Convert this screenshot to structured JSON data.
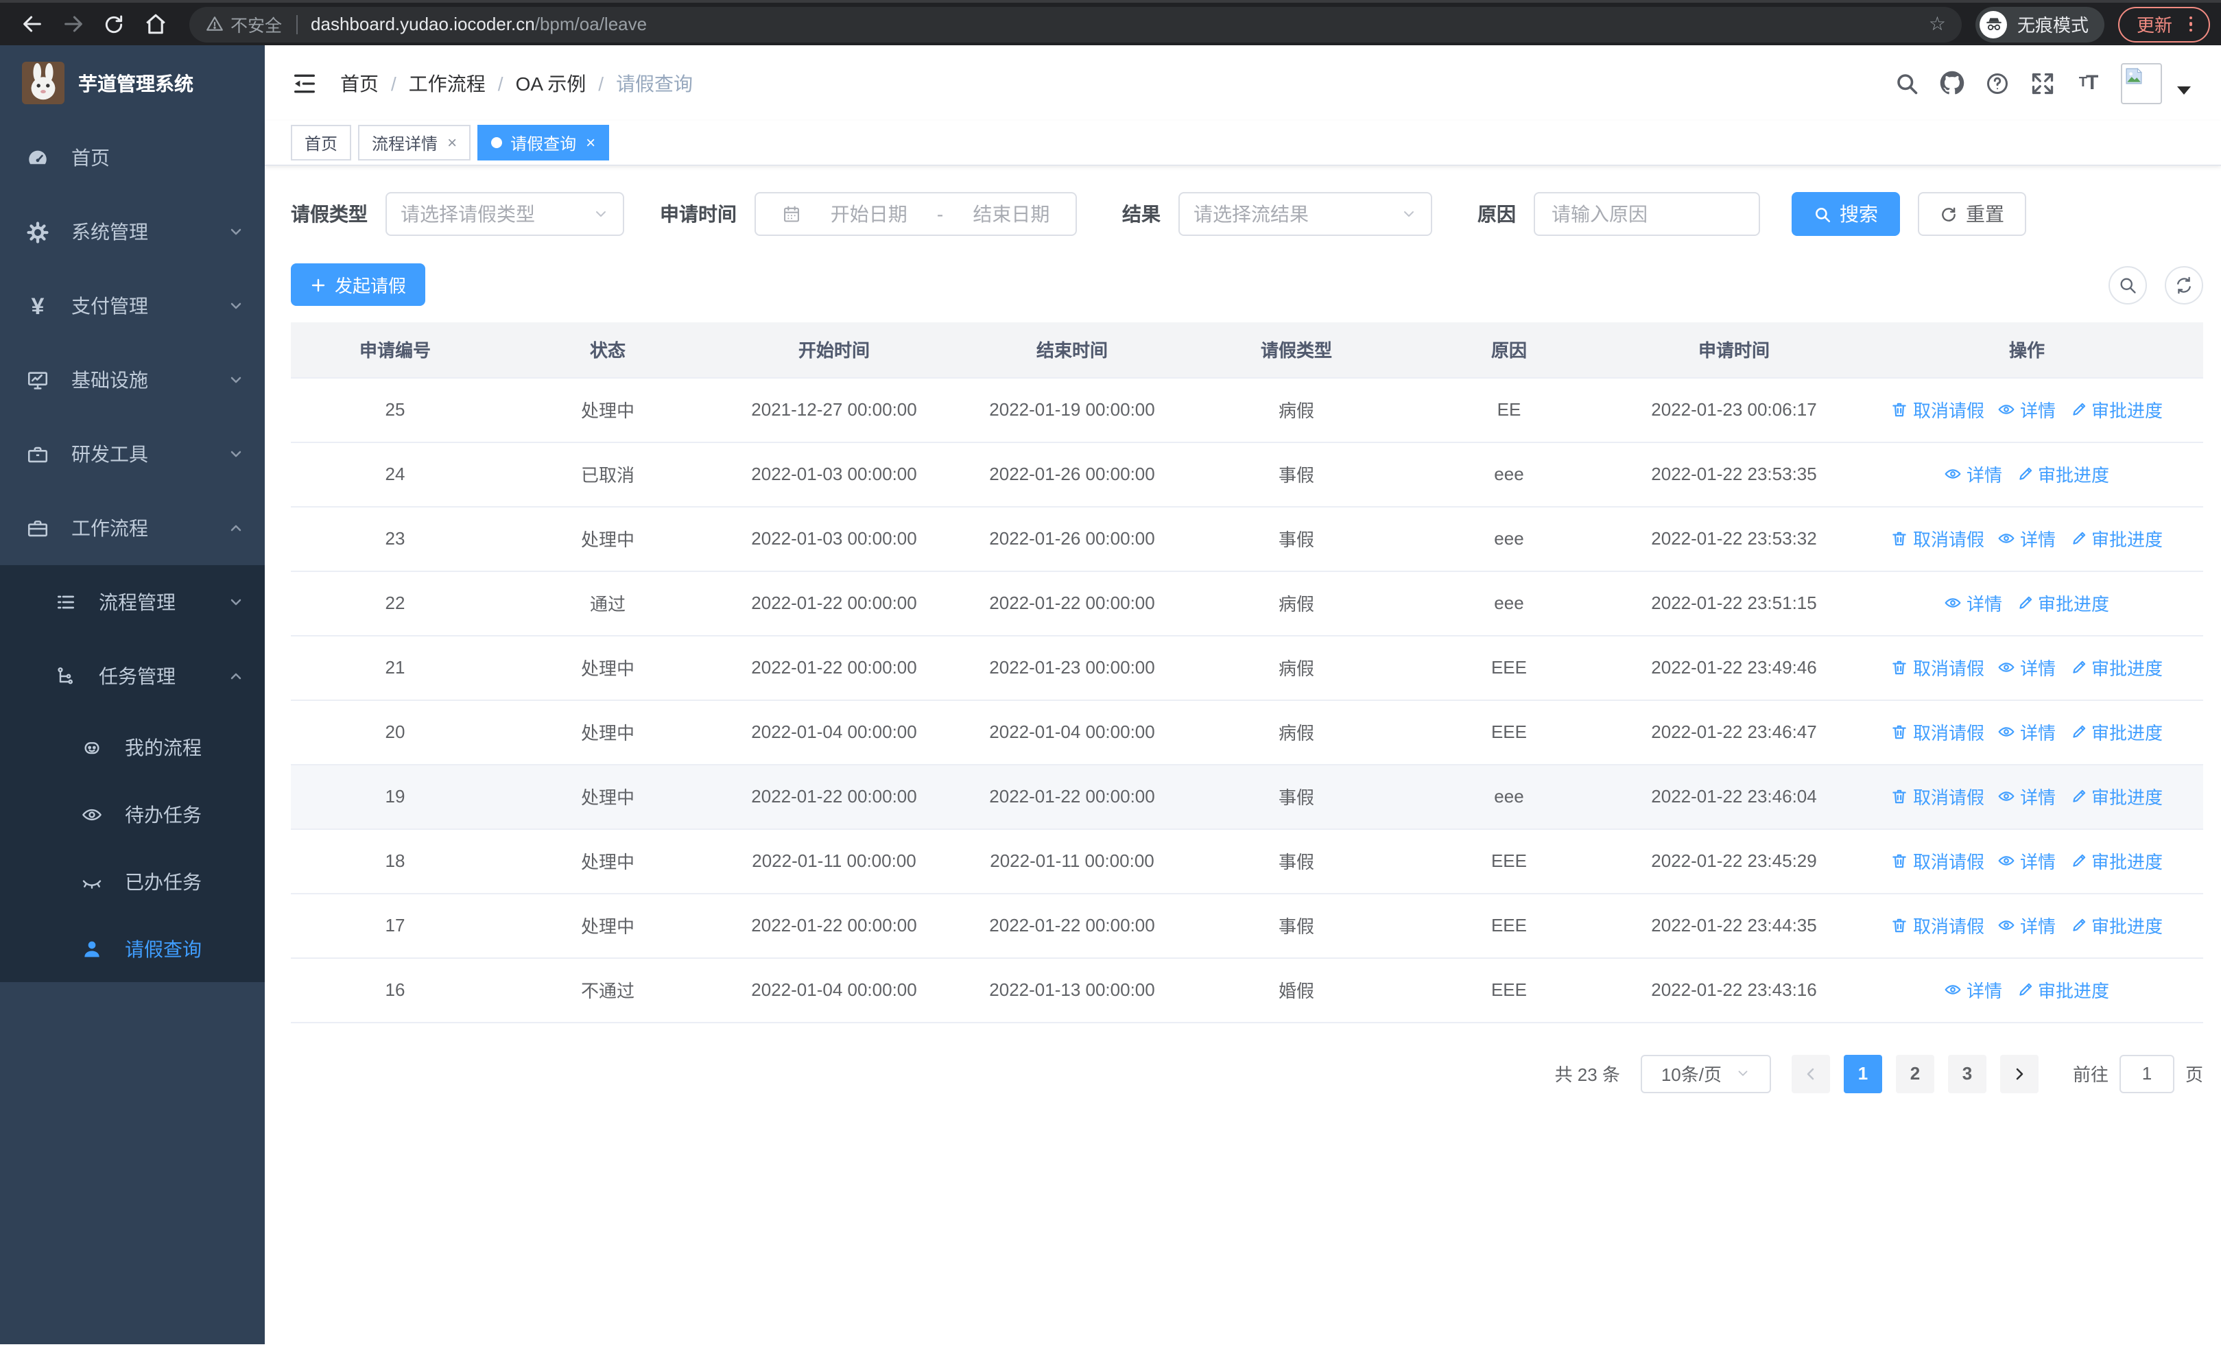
{
  "browser": {
    "security_label": "不安全",
    "url_domain": "dashboard.yudao.iocoder.cn",
    "url_path": "/bpm/oa/leave",
    "incognito_label": "无痕模式",
    "update_label": "更新"
  },
  "glyphs": {
    "star": "☆",
    "breadcrumb_separator": "/",
    "close": "×",
    "date_separator": "-"
  },
  "colors": {
    "accent": "#409eff",
    "sidebar_bg": "#304156",
    "submenu_bg": "#1f2d3d",
    "chrome_bg": "#202124",
    "update_accent": "#f28b82",
    "table_header_bg": "#f3f4f6"
  },
  "sidebar": {
    "logo_title": "芋道管理系统",
    "menu": [
      {
        "label": "首页",
        "icon": "dashboard-icon"
      },
      {
        "label": "系统管理",
        "icon": "gear-icon",
        "expandable": true
      },
      {
        "label": "支付管理",
        "icon": "yen-icon",
        "expandable": true
      },
      {
        "label": "基础设施",
        "icon": "monitor-icon",
        "expandable": true
      },
      {
        "label": "研发工具",
        "icon": "toolbox-icon",
        "expandable": true
      },
      {
        "label": "工作流程",
        "icon": "briefcase-icon",
        "expandable": true,
        "expanded": true,
        "children": [
          {
            "label": "流程管理",
            "icon": "list-icon",
            "expandable": true
          },
          {
            "label": "任务管理",
            "icon": "tree-icon",
            "expandable": true,
            "expanded": true,
            "children": [
              {
                "label": "我的流程",
                "icon": "robot-icon"
              },
              {
                "label": "待办任务",
                "icon": "eye-open-icon"
              },
              {
                "label": "已办任务",
                "icon": "eye-closed-icon"
              },
              {
                "label": "请假查询",
                "icon": "user-icon",
                "active": true
              }
            ]
          }
        ]
      }
    ]
  },
  "breadcrumb": {
    "items": [
      "首页",
      "工作流程",
      "OA 示例",
      "请假查询"
    ]
  },
  "tabs": [
    {
      "label": "首页",
      "active": false,
      "closable": false
    },
    {
      "label": "流程详情",
      "active": false,
      "closable": true
    },
    {
      "label": "请假查询",
      "active": true,
      "closable": true
    }
  ],
  "filters": {
    "leave_type": {
      "label": "请假类型",
      "placeholder": "请选择请假类型"
    },
    "apply_time": {
      "label": "申请时间",
      "start_placeholder": "开始日期",
      "separator": "-",
      "end_placeholder": "结束日期"
    },
    "result": {
      "label": "结果",
      "placeholder": "请选择流结果"
    },
    "reason": {
      "label": "原因",
      "placeholder": "请输入原因"
    },
    "search_label": "搜索",
    "reset_label": "重置"
  },
  "toolbar": {
    "create_label": "发起请假"
  },
  "table": {
    "columns": [
      "申请编号",
      "状态",
      "开始时间",
      "结束时间",
      "请假类型",
      "原因",
      "申请时间",
      "操作"
    ],
    "action_labels": {
      "cancel": "取消请假",
      "detail": "详情",
      "progress": "审批进度"
    },
    "rows": [
      {
        "id": "25",
        "status": "处理中",
        "start": "2021-12-27 00:00:00",
        "end": "2022-01-19 00:00:00",
        "type": "病假",
        "reason": "EE",
        "applied": "2022-01-23 00:06:17",
        "can_cancel": true,
        "hover": false
      },
      {
        "id": "24",
        "status": "已取消",
        "start": "2022-01-03 00:00:00",
        "end": "2022-01-26 00:00:00",
        "type": "事假",
        "reason": "eee",
        "applied": "2022-01-22 23:53:35",
        "can_cancel": false,
        "hover": false
      },
      {
        "id": "23",
        "status": "处理中",
        "start": "2022-01-03 00:00:00",
        "end": "2022-01-26 00:00:00",
        "type": "事假",
        "reason": "eee",
        "applied": "2022-01-22 23:53:32",
        "can_cancel": true,
        "hover": false
      },
      {
        "id": "22",
        "status": "通过",
        "start": "2022-01-22 00:00:00",
        "end": "2022-01-22 00:00:00",
        "type": "病假",
        "reason": "eee",
        "applied": "2022-01-22 23:51:15",
        "can_cancel": false,
        "hover": false
      },
      {
        "id": "21",
        "status": "处理中",
        "start": "2022-01-22 00:00:00",
        "end": "2022-01-23 00:00:00",
        "type": "病假",
        "reason": "EEE",
        "applied": "2022-01-22 23:49:46",
        "can_cancel": true,
        "hover": false
      },
      {
        "id": "20",
        "status": "处理中",
        "start": "2022-01-04 00:00:00",
        "end": "2022-01-04 00:00:00",
        "type": "病假",
        "reason": "EEE",
        "applied": "2022-01-22 23:46:47",
        "can_cancel": true,
        "hover": false
      },
      {
        "id": "19",
        "status": "处理中",
        "start": "2022-01-22 00:00:00",
        "end": "2022-01-22 00:00:00",
        "type": "事假",
        "reason": "eee",
        "applied": "2022-01-22 23:46:04",
        "can_cancel": true,
        "hover": true
      },
      {
        "id": "18",
        "status": "处理中",
        "start": "2022-01-11 00:00:00",
        "end": "2022-01-11 00:00:00",
        "type": "事假",
        "reason": "EEE",
        "applied": "2022-01-22 23:45:29",
        "can_cancel": true,
        "hover": false
      },
      {
        "id": "17",
        "status": "处理中",
        "start": "2022-01-22 00:00:00",
        "end": "2022-01-22 00:00:00",
        "type": "事假",
        "reason": "EEE",
        "applied": "2022-01-22 23:44:35",
        "can_cancel": true,
        "hover": false
      },
      {
        "id": "16",
        "status": "不通过",
        "start": "2022-01-04 00:00:00",
        "end": "2022-01-13 00:00:00",
        "type": "婚假",
        "reason": "EEE",
        "applied": "2022-01-22 23:43:16",
        "can_cancel": false,
        "hover": false
      }
    ]
  },
  "pagination": {
    "total_label": "共 23 条",
    "page_size": "10条/页",
    "pages": [
      "1",
      "2",
      "3"
    ],
    "active_page": "1",
    "goto_label": "前往",
    "goto_value": "1",
    "goto_suffix": "页"
  }
}
